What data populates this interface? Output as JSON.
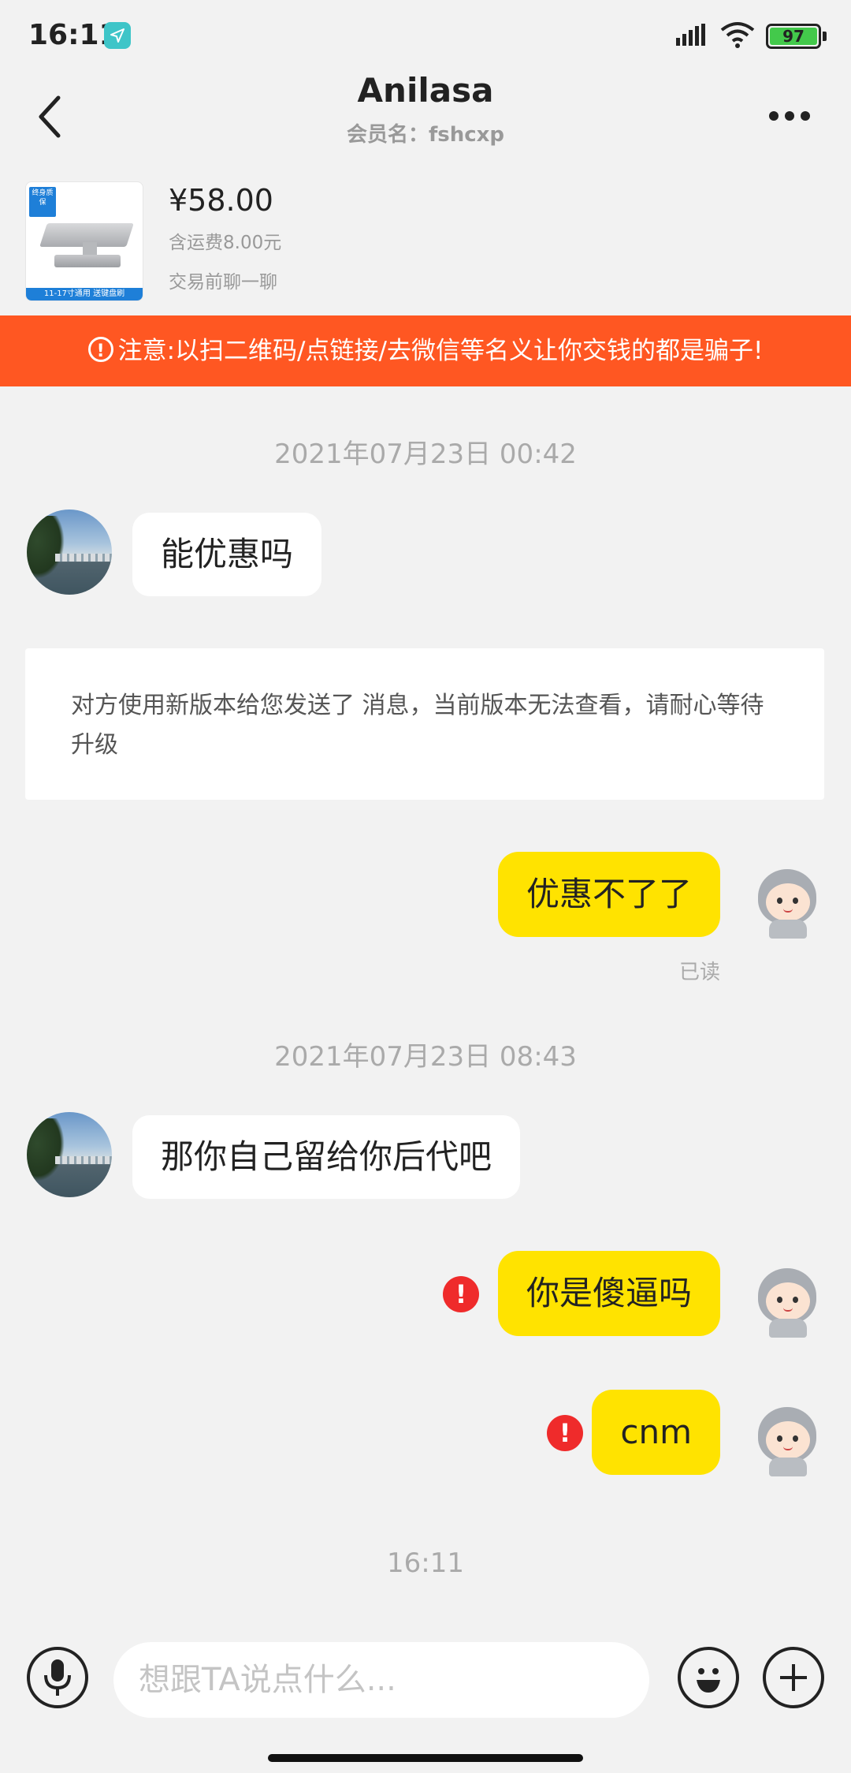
{
  "status_bar": {
    "time": "16:11",
    "battery": "97",
    "icons": [
      "navigation-icon",
      "signal-icon",
      "wifi-icon",
      "battery-icon"
    ]
  },
  "header": {
    "title": "Anilasa",
    "subtitle": "会员名：fshcxp",
    "back_icon": "chevron-left-icon",
    "more_icon": "more-dots-icon"
  },
  "product": {
    "price": "¥58.00",
    "shipping": "含运费8.00元",
    "chat_prompt": "交易前聊一聊",
    "image_badge": "终身质保",
    "image_strip": "11-17寸通用 送键盘刷"
  },
  "warning": {
    "text": "注意:以扫二维码/点链接/去微信等名义让你交钱的都是骗子!",
    "icon": "alert-circle-icon",
    "background": "#ff5722"
  },
  "messages": {
    "time1": "2021年07月23日 00:42",
    "msg1": "能优惠吗",
    "notice": "对方使用新版本给您发送了 消息，当前版本无法查看，请耐心等待升级",
    "msg2": "优惠不了了",
    "read_label": "已读",
    "time2": "2021年07月23日 08:43",
    "msg3": "那你自己留给你后代吧",
    "msg4": "你是傻逼吗",
    "msg5": "cnm",
    "error_mark": "!",
    "time3": "16:11",
    "bubble_color_mine": "#ffe300"
  },
  "input": {
    "placeholder": "想跟TA说点什么...",
    "voice_icon": "microphone-icon",
    "emoji_icon": "emoji-icon",
    "plus_icon": "plus-icon"
  }
}
